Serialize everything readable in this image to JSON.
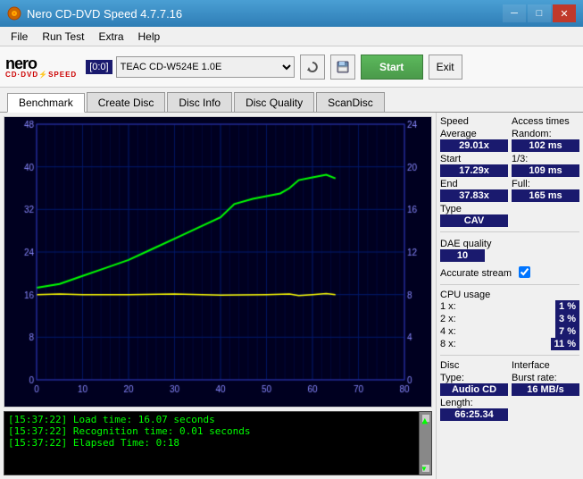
{
  "titleBar": {
    "title": "Nero CD-DVD Speed 4.7.7.16",
    "controls": {
      "minimize": "─",
      "maximize": "□",
      "close": "✕"
    }
  },
  "menuBar": {
    "items": [
      "File",
      "Run Test",
      "Extra",
      "Help"
    ]
  },
  "toolbar": {
    "driveLabel": "[0:0]",
    "driveValue": "TEAC CD-W524E 1.0E",
    "startLabel": "Start",
    "exitLabel": "Exit"
  },
  "tabs": {
    "items": [
      "Benchmark",
      "Create Disc",
      "Disc Info",
      "Disc Quality",
      "ScanDisc"
    ],
    "active": 0
  },
  "rightPanel": {
    "speed": {
      "title": "Speed",
      "averageLabel": "Average",
      "averageValue": "29.01x",
      "startLabel": "Start",
      "startValue": "17.29x",
      "endLabel": "End",
      "endValue": "37.83x",
      "typeLabel": "Type",
      "typeValue": "CAV"
    },
    "accessTimes": {
      "title": "Access times",
      "randomLabel": "Random:",
      "randomValue": "102 ms",
      "oneThirdLabel": "1/3:",
      "oneThirdValue": "109 ms",
      "fullLabel": "Full:",
      "fullValue": "165 ms"
    },
    "daeQuality": {
      "label": "DAE quality",
      "value": "10"
    },
    "accurateStream": {
      "label": "Accurate stream",
      "checked": true
    },
    "cpuUsage": {
      "title": "CPU usage",
      "rows": [
        {
          "label": "1 x:",
          "value": "1 %"
        },
        {
          "label": "2 x:",
          "value": "3 %"
        },
        {
          "label": "4 x:",
          "value": "7 %"
        },
        {
          "label": "8 x:",
          "value": "11 %"
        }
      ]
    },
    "disc": {
      "title": "Disc",
      "typeLabel": "Type:",
      "typeValue": "Audio CD",
      "lengthLabel": "Length:",
      "lengthValue": "66:25.34"
    },
    "interface": {
      "title": "Interface",
      "burstRateLabel": "Burst rate:",
      "burstRateValue": "16 MB/s"
    }
  },
  "chart": {
    "leftYLabels": [
      "48",
      "40",
      "32",
      "24",
      "16",
      "8"
    ],
    "rightYLabels": [
      "24",
      "20",
      "16",
      "12",
      "8",
      "4"
    ],
    "xLabels": [
      "0",
      "10",
      "20",
      "30",
      "40",
      "50",
      "60",
      "70",
      "80"
    ]
  },
  "log": {
    "entries": [
      "[15:37:22]  Load time: 16.07 seconds",
      "[15:37:22]  Recognition time: 0.01 seconds",
      "[15:37:22]  Elapsed Time: 0:18"
    ]
  }
}
